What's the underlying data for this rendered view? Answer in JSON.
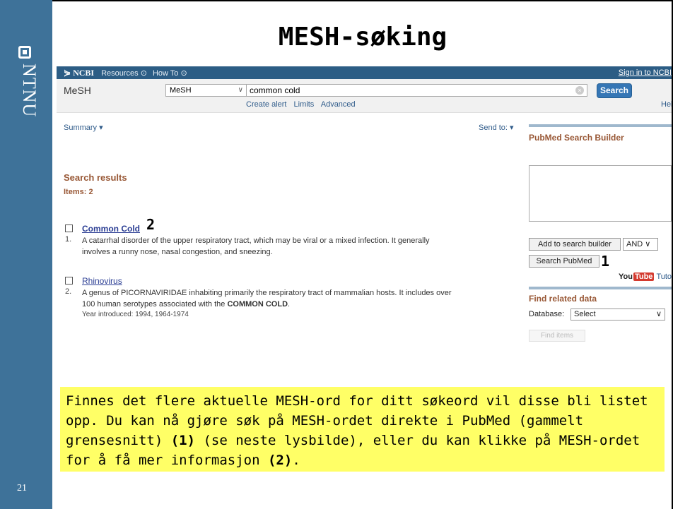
{
  "slide": {
    "logo_text": "NTNU",
    "title": "MESH-søking",
    "page_number": "21",
    "band_color": "#3e7299"
  },
  "ncbi": {
    "logo": "NCBI",
    "menu_resources": "Resources",
    "menu_howto": "How To",
    "signin": "Sign in to NCBI",
    "db_name": "MeSH",
    "db_select_value": "MeSH",
    "search_term": "common cold",
    "search_button": "Search",
    "links": [
      "Create alert",
      "Limits",
      "Advanced"
    ],
    "help": "Help",
    "summary": "Summary",
    "send_to": "Send to:",
    "results_heading": "Search results",
    "items": "Items: 2",
    "results": [
      {
        "num": "1.",
        "title": "Common Cold",
        "marker": "2",
        "desc_line1": "A catarrhal disorder of the upper respiratory tract, which may be viral or a mixed infection. It generally",
        "desc_line2": "involves a runny nose, nasal congestion, and sneezing."
      },
      {
        "num": "2.",
        "title": "Rhinovirus",
        "desc_line1": "A genus of PICORNAVIRIDAE inhabiting primarily the respiratory tract of mammalian hosts. It includes over",
        "desc_line2_pre": "100 human serotypes associated with the ",
        "desc_line2_bold": "COMMON COLD",
        "desc_line2_post": ".",
        "year": "Year introduced: 1994, 1964-1974"
      }
    ],
    "sidebar": {
      "builder_title": "PubMed Search Builder",
      "add_button": "Add to search builder",
      "and_select": "AND",
      "search_pubmed": "Search PubMed",
      "marker": "1",
      "youtube_you": "You",
      "youtube_tube": "Tube",
      "tutorial": "Tutorial",
      "related_title": "Find related data",
      "database_label": "Database:",
      "database_value": "Select",
      "find_items": "Find items"
    }
  },
  "note": {
    "part1": "Finnes det flere aktuelle MESH-ord for ditt søkeord vil disse bli listet opp. Du kan nå gjøre søk på MESH-ordet direkte i PubMed (gammelt grensesnitt) ",
    "ref1": "(1)",
    "part2": " (se neste lysbilde), eller du kan klikke på MESH-ordet for å få mer informasjon ",
    "ref2": "(2)",
    "part3": "."
  }
}
